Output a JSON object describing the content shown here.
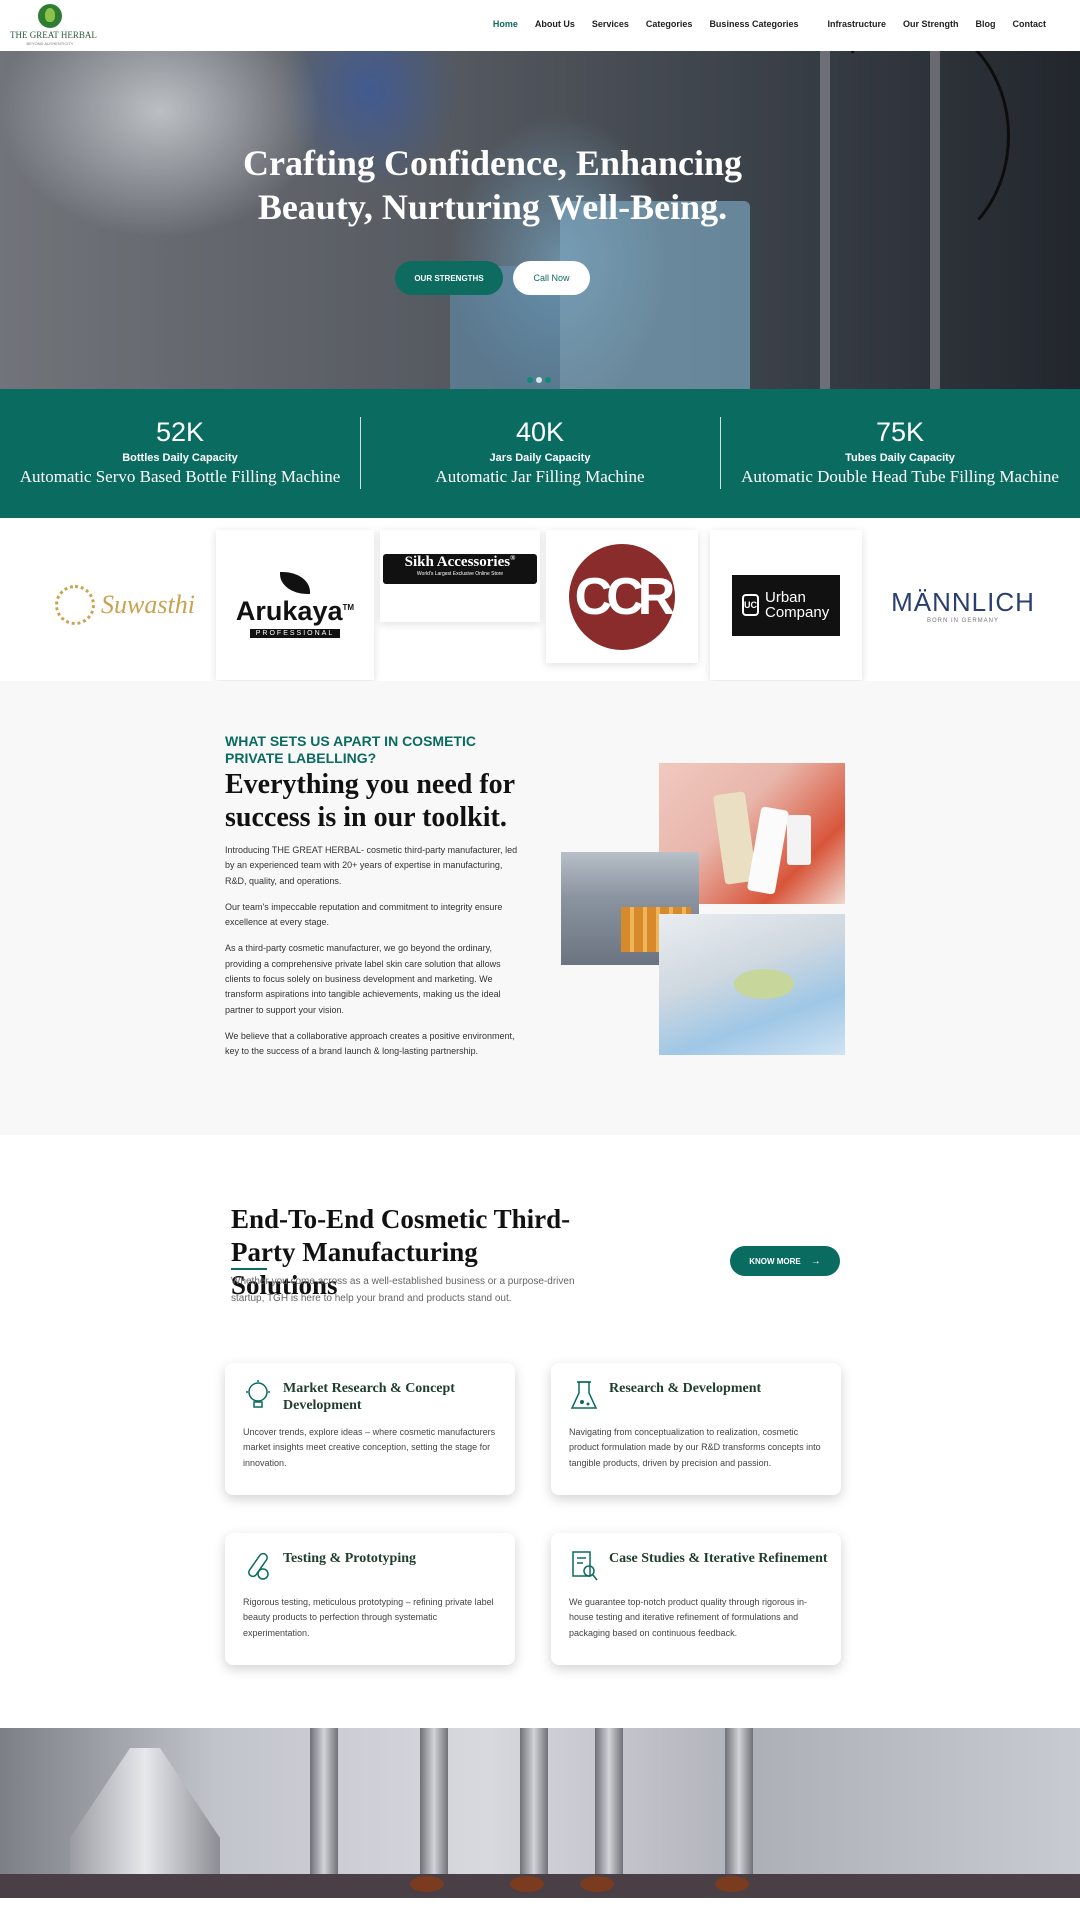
{
  "brand": {
    "name": "THE GREAT HERBAL",
    "tagline": "BEYOND AUTHENTICITY"
  },
  "nav": [
    {
      "label": "Home"
    },
    {
      "label": "About Us"
    },
    {
      "label": "Services"
    },
    {
      "label": "Categories"
    },
    {
      "label": "Business Categories"
    },
    {
      "label": "Infrastructure"
    },
    {
      "label": "Our Strength"
    },
    {
      "label": "Blog"
    },
    {
      "label": "Contact"
    }
  ],
  "hero": {
    "title": "Crafting Confidence, Enhancing Beauty, Nurturing Well-Being.",
    "primary_button": "OUR STRENGTHS",
    "secondary_button": "Call Now"
  },
  "stats": [
    {
      "value": "52K",
      "label": "Bottles Daily Capacity",
      "desc": "Automatic Servo Based Bottle Filling Machine"
    },
    {
      "value": "40K",
      "label": "Jars Daily Capacity",
      "desc": "Automatic Jar Filling Machine"
    },
    {
      "value": "75K",
      "label": "Tubes Daily Capacity",
      "desc": "Automatic Double Head Tube Filling Machine"
    }
  ],
  "brands": {
    "suwasthi": "Suwasthi",
    "arukaya": "Arukaya",
    "arukaya_tm": "TM",
    "arukaya_sub": "PROFESSIONAL",
    "sikh": "Sikh Accessories",
    "sikh_tm": "®",
    "sikh_sub": "World's Largest Exclusive Online Store",
    "ccr": "CCR",
    "urban_icon": "UC",
    "urban": "Urban Company",
    "mannlich": "MÄNNLICH",
    "mannlich_sub": "BORN IN GERMANY"
  },
  "about": {
    "eyebrow": "WHAT SETS US APART IN COSMETIC PRIVATE LABELLING?",
    "title": "Everything you need for success is in our toolkit.",
    "p1": "Introducing THE GREAT HERBAL- cosmetic third-party manufacturer, led by an experienced team with 20+ years of expertise in manufacturing, R&D, quality, and operations.",
    "p2": "Our team's impeccable reputation and commitment to integrity ensure excellence at every stage.",
    "p3": "As a third-party cosmetic manufacturer, we go beyond the ordinary, providing a comprehensive private label skin care solution that allows clients to focus solely on business development and marketing. We transform aspirations into tangible achievements, making us the ideal partner to support your vision.",
    "p4": "We believe that a collaborative approach creates a positive environment, key to the success of a brand launch & long-lasting partnership."
  },
  "solutions": {
    "title": "End-To-End Cosmetic Third-Party Manufacturing Solutions",
    "subtitle": "Whether you come across as a well-established business or a purpose-driven startup, TGH is here to help your brand and products stand out.",
    "button": "KNOW MORE",
    "cards": [
      {
        "icon": "lightbulb-icon",
        "title": "Market Research & Concept Development",
        "text": "Uncover trends, explore ideas – where cosmetic manufacturers market insights meet creative conception, setting the stage for innovation."
      },
      {
        "icon": "flask-icon",
        "title": "Research & Development",
        "text": "Navigating from conceptualization to realization, cosmetic product formulation made by our R&D transforms concepts into tangible products, driven by precision and passion."
      },
      {
        "icon": "test-tube-icon",
        "title": "Testing & Prototyping",
        "text": "Rigorous testing, meticulous prototyping – refining private label beauty products to perfection through systematic experimentation."
      },
      {
        "icon": "document-search-icon",
        "title": "Case Studies & Iterative Refinement",
        "text": "We guarantee top-notch product quality through rigorous in-house testing and iterative refinement of formulations and packaging based on continuous feedback."
      }
    ]
  },
  "colors": {
    "brand_green": "#0a6b60",
    "text_dark": "#111111"
  }
}
